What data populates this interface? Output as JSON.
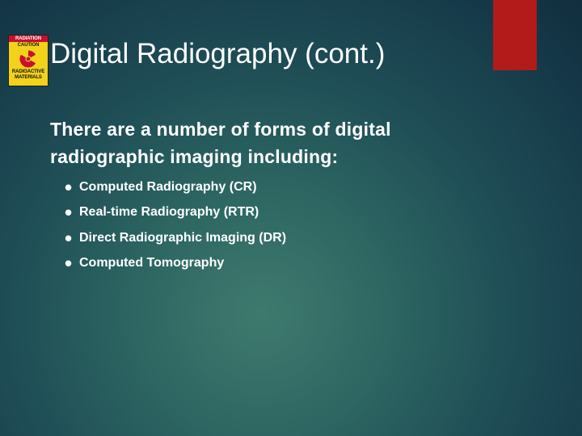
{
  "slide": {
    "title": "Digital Radiography (cont.)",
    "intro": "There are a number of  forms of digital radiographic imaging including:",
    "bullets": [
      "Computed Radiography (CR)",
      "Real-time Radiography (RTR)",
      "Direct Radiographic Imaging (DR)",
      "Computed Tomography"
    ]
  },
  "logo": {
    "line1": "RADIATION",
    "line2": "CAUTION",
    "line3": "RADIOACTIVE",
    "line4": "MATERIALS",
    "icon": "radiation-trefoil-icon"
  },
  "colors": {
    "accent": "#b31b1b",
    "logo_bg": "#f2d21b",
    "trefoil": "#c8102e",
    "text": "#ffffff"
  }
}
